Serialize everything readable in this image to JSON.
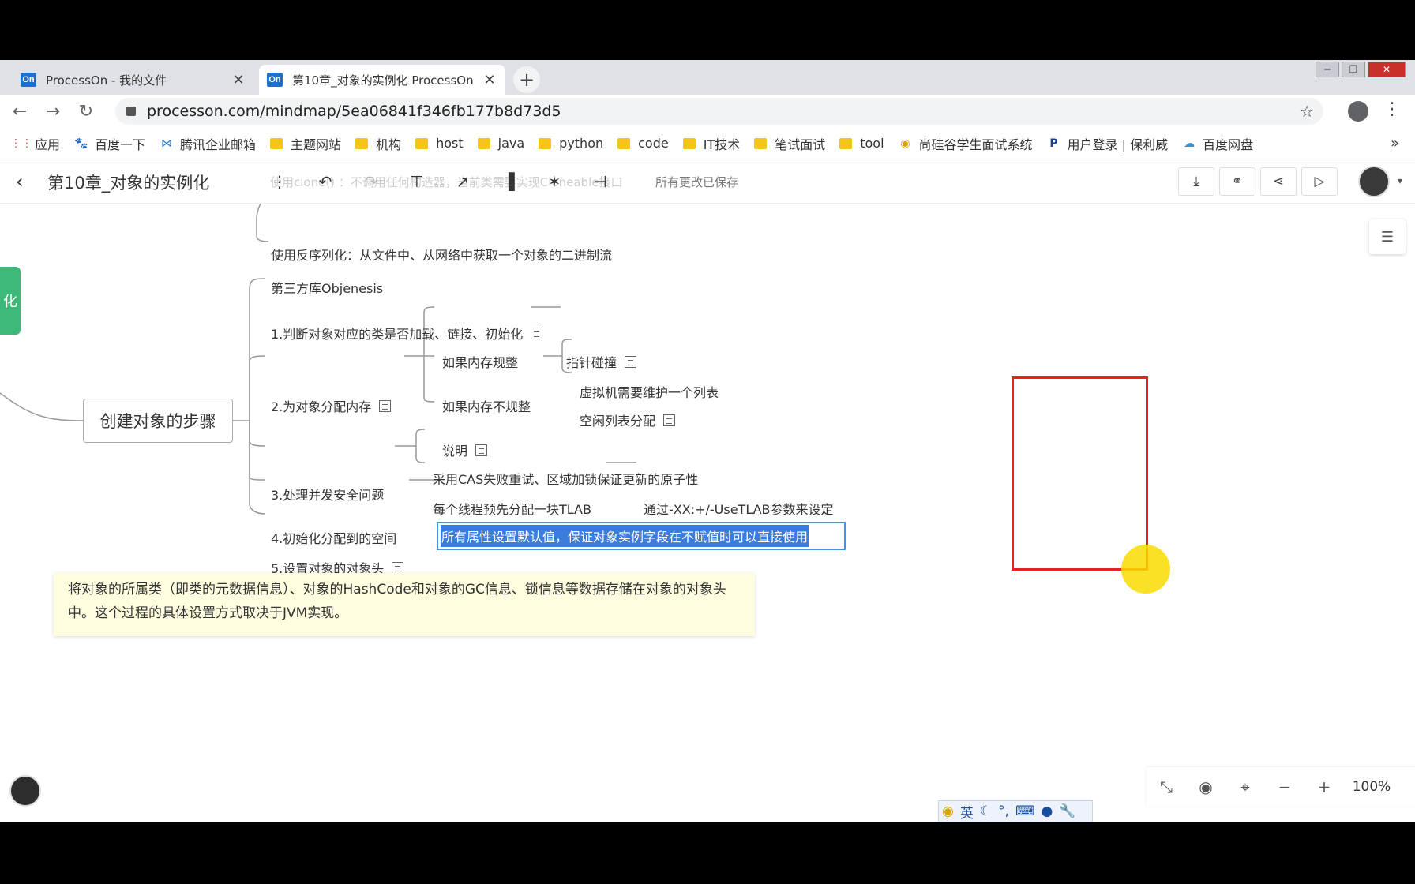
{
  "browser": {
    "tabs": [
      {
        "favicon": "On",
        "title": "ProcessOn - 我的文件"
      },
      {
        "favicon": "On",
        "title": "第10章_对象的实例化 ProcessOn"
      }
    ],
    "url": "processon.com/mindmap/5ea06841f346fb177b8d73d5",
    "bookmarks": [
      "应用",
      "百度一下",
      "腾讯企业邮箱",
      "主题网站",
      "机构",
      "host",
      "java",
      "python",
      "code",
      "IT技术",
      "笔试面试",
      "tool",
      "尚硅谷学生面试系统",
      "用户登录 | 保利威",
      "百度网盘"
    ]
  },
  "app": {
    "doc_title": "第10章_对象的实例化",
    "save_status": "所有更改已保存",
    "ghost_text": "使用clone() ：不调用任何构造器，当前类需要实现Cloneable接口",
    "zoom": "100%",
    "ime_label": "英"
  },
  "mindmap": {
    "top_items": [
      "使用反序列化：从文件中、从网络中获取一个对象的二进制流",
      "第三方库Objenesis"
    ],
    "side_tab": "化",
    "root": "创建对象的步骤",
    "step1": "1.判断对象对应的类是否加载、链接、初始化",
    "step2": "2.为对象分配内存",
    "step2_a": "如果内存规整",
    "step2_a1": "指针碰撞",
    "step2_b": "如果内存不规整",
    "step2_b1": "虚拟机需要维护一个列表",
    "step2_b2": "空闲列表分配",
    "step2_c": "说明",
    "step3": "3.处理并发安全问题",
    "step3_a": "采用CAS失败重试、区域加锁保证更新的原子性",
    "step3_b": "每个线程预先分配一块TLAB",
    "step3_b1": "通过-XX:+/-UseTLAB参数来设定",
    "step4": "4.初始化分配到的空间",
    "step4_a": "所有属性设置默认值，保证对象实例字段在不赋值时可以直接使用",
    "step5": "5.设置对象的对象头",
    "tooltip": "将对象的所属类（即类的元数据信息）、对象的HashCode和对象的GC信息、锁信息等数据存储在对象的对象头中。这个过程的具体设置方式取决于JVM实现。"
  },
  "colors": {
    "accent": "#3b7ddd",
    "annotation": "#e8211c",
    "highlight": "#fadc00",
    "tooltip_bg": "#fffde0"
  }
}
